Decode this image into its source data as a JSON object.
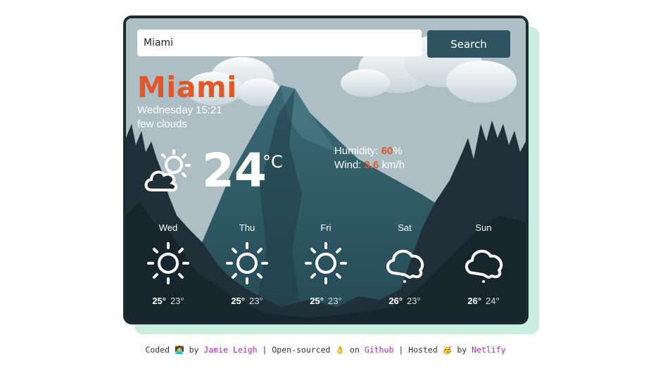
{
  "search": {
    "value": "Miami",
    "button_label": "Search"
  },
  "current": {
    "city": "Miami",
    "datetime": "Wednesday 15:21",
    "description": "few clouds",
    "icon": "partly-cloudy-icon",
    "temperature": "24",
    "unit": "°C",
    "humidity_label": "Humidity:",
    "humidity_value": "60",
    "humidity_unit": "%",
    "wind_label": "Wind:",
    "wind_value": "3.6",
    "wind_unit": "km/h"
  },
  "forecast": [
    {
      "day": "Wed",
      "icon": "sun-icon",
      "high": "25°",
      "low": "23°"
    },
    {
      "day": "Thu",
      "icon": "sun-icon",
      "high": "25°",
      "low": "23°"
    },
    {
      "day": "Fri",
      "icon": "sun-icon",
      "high": "25°",
      "low": "23°"
    },
    {
      "day": "Sat",
      "icon": "cloud-icon",
      "high": "26°",
      "low": "23°"
    },
    {
      "day": "Sun",
      "icon": "cloud-icon",
      "high": "26°",
      "low": "24°"
    }
  ],
  "footer": {
    "coded": "Coded",
    "coded_emoji": "🧑‍💻",
    "by1": "by",
    "author": "Jamie Leigh",
    "sep1": "|",
    "open_sourced": "Open-sourced",
    "open_emoji": "👌",
    "on": "on",
    "github": "Github",
    "sep2": "|",
    "hosted": "Hosted",
    "hosted_emoji": "🥳",
    "by2": "by",
    "netlify": "Netlify"
  },
  "colors": {
    "accent": "#e0582a",
    "button": "#2e5461",
    "card_border": "#1b2b30",
    "shadow": "#c9eee0",
    "link": "#b026c9"
  }
}
